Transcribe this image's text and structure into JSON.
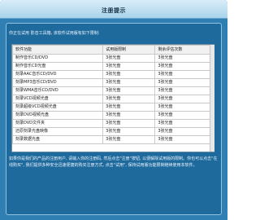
{
  "dialog": {
    "title": "注册提示",
    "intro": "你正在试用 影音工具箱, 该软件试用版有如下限制:",
    "footer": "如果你是我们的产品的注册用户, 请输入你的注册码, 然后点击\"注册\"按钮, 以便解除试用版的限制。你也可以点击\"在线购买\", 我们提供多种安全迅速便捷的购买注册方式, 点击\"试用\", 保持试用版功能限制继续使用本软件。"
  },
  "table": {
    "headers": [
      "软件功能",
      "试用版限制",
      "剩余评估次数"
    ],
    "rows": [
      [
        "制作音乐CD/DVD",
        "3张光盘",
        "3张光盘"
      ],
      [
        "制作音乐CD光盘",
        "3张光盘",
        "3张光盘"
      ],
      [
        "刻录AAC音乐CD/DVD",
        "3张光盘",
        "3张光盘"
      ],
      [
        "刻录MP3音乐CD/DVD",
        "3张光盘",
        "3张光盘"
      ],
      [
        "刻录WMA音乐CD/DVD",
        "3张光盘",
        "3张光盘"
      ],
      [
        "刻录VCD视频光盘",
        "3张光盘",
        "3张光盘"
      ],
      [
        "刻录超级VCD视频光盘",
        "3张光盘",
        "3张光盘"
      ],
      [
        "刻录DVD视频光盘",
        "3张光盘",
        "3张光盘"
      ],
      [
        "刻录DVD文件夹",
        "3张光盘",
        "3张光盘"
      ],
      [
        "还原刻录光盘映像",
        "3张光盘",
        "3张光盘"
      ],
      [
        "刻录数据光盘",
        "3张光盘",
        "3张光盘"
      ]
    ]
  }
}
